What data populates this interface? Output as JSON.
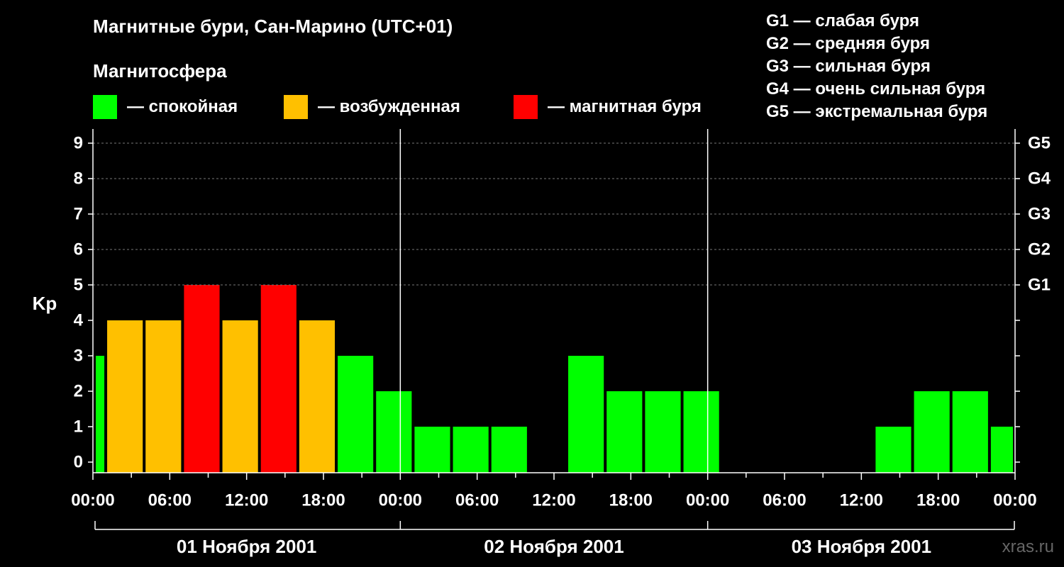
{
  "title": "Магнитные бури, Сан-Марино (UTC+01)",
  "subtitle": "Магнитосфера",
  "legend": [
    {
      "label": "— спокойная",
      "color": "#00ff00"
    },
    {
      "label": "— возбужденная",
      "color": "#ffc000"
    },
    {
      "label": "— магнитная буря",
      "color": "#ff0000"
    }
  ],
  "g_legend": [
    "G1 — слабая буря",
    "G2 — средняя буря",
    "G3 — сильная буря",
    "G4 — очень сильная буря",
    "G5 — экстремальная буря"
  ],
  "watermark": "xras.ru",
  "chart_data": {
    "type": "bar",
    "ylabel": "Kp",
    "ylim": [
      0,
      9
    ],
    "y_ticks": [
      "0",
      "1",
      "2",
      "3",
      "4",
      "5",
      "6",
      "7",
      "8",
      "9"
    ],
    "y_right_ticks": [
      {
        "value": 5,
        "label": "G1"
      },
      {
        "value": 6,
        "label": "G2"
      },
      {
        "value": 7,
        "label": "G3"
      },
      {
        "value": 8,
        "label": "G4"
      },
      {
        "value": 9,
        "label": "G5"
      }
    ],
    "x_tick_labels": [
      "00:00",
      "06:00",
      "12:00",
      "18:00",
      "00:00",
      "06:00",
      "12:00",
      "18:00",
      "00:00",
      "06:00",
      "12:00",
      "18:00",
      "00:00"
    ],
    "days": [
      "01 Ноября 2001",
      "02 Ноября 2001",
      "03 Ноября 2001"
    ],
    "grid": true,
    "colors": {
      "quiet": "#00ff00",
      "disturbed": "#ffc000",
      "storm": "#ff0000"
    },
    "bars": [
      {
        "start": "01 Ноября 2001 00:00",
        "end": "01 Ноября 2001 01:00",
        "kp": 3,
        "level": "quiet"
      },
      {
        "start": "01 Ноября 2001 01:00",
        "end": "01 Ноября 2001 04:00",
        "kp": 4,
        "level": "disturbed"
      },
      {
        "start": "01 Ноября 2001 04:00",
        "end": "01 Ноября 2001 07:00",
        "kp": 4,
        "level": "disturbed"
      },
      {
        "start": "01 Ноября 2001 07:00",
        "end": "01 Ноября 2001 10:00",
        "kp": 5,
        "level": "storm"
      },
      {
        "start": "01 Ноября 2001 10:00",
        "end": "01 Ноября 2001 13:00",
        "kp": 4,
        "level": "disturbed"
      },
      {
        "start": "01 Ноября 2001 13:00",
        "end": "01 Ноября 2001 16:00",
        "kp": 5,
        "level": "storm"
      },
      {
        "start": "01 Ноября 2001 16:00",
        "end": "01 Ноября 2001 19:00",
        "kp": 4,
        "level": "disturbed"
      },
      {
        "start": "01 Ноября 2001 19:00",
        "end": "01 Ноября 2001 22:00",
        "kp": 3,
        "level": "quiet"
      },
      {
        "start": "01 Ноября 2001 22:00",
        "end": "02 Ноября 2001 01:00",
        "kp": 2,
        "level": "quiet"
      },
      {
        "start": "02 Ноября 2001 01:00",
        "end": "02 Ноября 2001 04:00",
        "kp": 1,
        "level": "quiet"
      },
      {
        "start": "02 Ноября 2001 04:00",
        "end": "02 Ноября 2001 07:00",
        "kp": 1,
        "level": "quiet"
      },
      {
        "start": "02 Ноября 2001 07:00",
        "end": "02 Ноября 2001 10:00",
        "kp": 1,
        "level": "quiet"
      },
      {
        "start": "02 Ноября 2001 13:00",
        "end": "02 Ноября 2001 16:00",
        "kp": 3,
        "level": "quiet"
      },
      {
        "start": "02 Ноября 2001 16:00",
        "end": "02 Ноября 2001 19:00",
        "kp": 2,
        "level": "quiet"
      },
      {
        "start": "02 Ноября 2001 19:00",
        "end": "02 Ноября 2001 22:00",
        "kp": 2,
        "level": "quiet"
      },
      {
        "start": "02 Ноября 2001 22:00",
        "end": "03 Ноября 2001 01:00",
        "kp": 2,
        "level": "quiet"
      },
      {
        "start": "03 Ноября 2001 13:00",
        "end": "03 Ноября 2001 16:00",
        "kp": 1,
        "level": "quiet"
      },
      {
        "start": "03 Ноября 2001 16:00",
        "end": "03 Ноября 2001 19:00",
        "kp": 2,
        "level": "quiet"
      },
      {
        "start": "03 Ноября 2001 19:00",
        "end": "03 Ноября 2001 22:00",
        "kp": 2,
        "level": "quiet"
      },
      {
        "start": "03 Ноября 2001 22:00",
        "end": "04 Ноября 2001 00:00",
        "kp": 1,
        "level": "quiet"
      }
    ]
  }
}
